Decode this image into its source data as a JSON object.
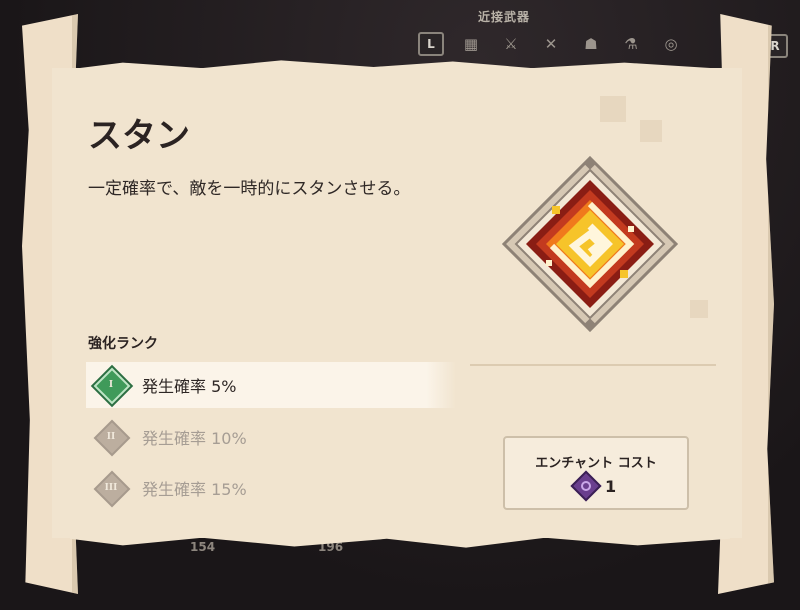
{
  "header": {
    "category": "近接武器",
    "key_left": "L",
    "key_right": "R",
    "tools": [
      "grid-icon",
      "sword-icon",
      "crossbow-icon",
      "armor-icon",
      "potion-icon",
      "enchant-spiral-icon"
    ]
  },
  "bottom_counts": [
    "154",
    "196"
  ],
  "enchant": {
    "title": "スタン",
    "description": "一定確率で、敵を一時的にスタンさせる。",
    "icon": "stun-spiral-icon"
  },
  "ranks": {
    "heading": "強化ランク",
    "items": [
      {
        "numeral": "I",
        "label": "発生確率 5%",
        "active": true
      },
      {
        "numeral": "II",
        "label": "発生確率 10%",
        "active": false
      },
      {
        "numeral": "III",
        "label": "発生確率 15%",
        "active": false
      }
    ]
  },
  "cost": {
    "title": "エンチャント コスト",
    "value": "1",
    "icon": "enchantment-point-icon"
  },
  "colors": {
    "parchment": "#f1e4cf",
    "active_rank": "#3f9a5a",
    "emblem_red": "#b52a1c",
    "emblem_yellow": "#f2c21a"
  }
}
